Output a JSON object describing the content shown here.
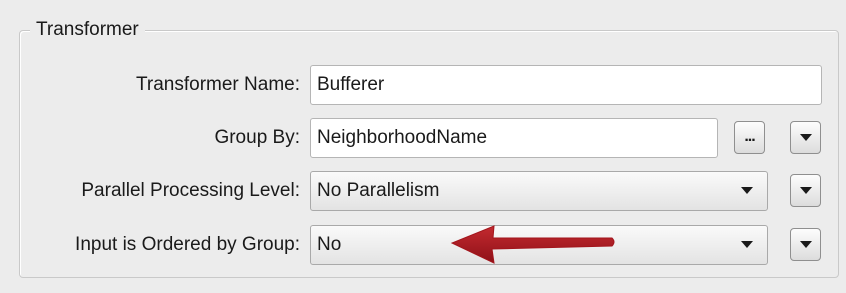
{
  "group": {
    "title": "Transformer"
  },
  "rows": {
    "name": {
      "label": "Transformer Name:",
      "value": "Bufferer"
    },
    "group_by": {
      "label": "Group By:",
      "value": "NeighborhoodName",
      "browse_label": "..."
    },
    "parallel": {
      "label": "Parallel Processing Level:",
      "value": "No Parallelism"
    },
    "ordered": {
      "label": "Input is Ordered by Group:",
      "value": "No"
    }
  },
  "icons": {
    "menu": "triangle-down-icon",
    "combo": "chevron-down-icon",
    "annotation": "red-arrow-icon"
  },
  "colors": {
    "annotation_arrow": "#a3151c"
  }
}
